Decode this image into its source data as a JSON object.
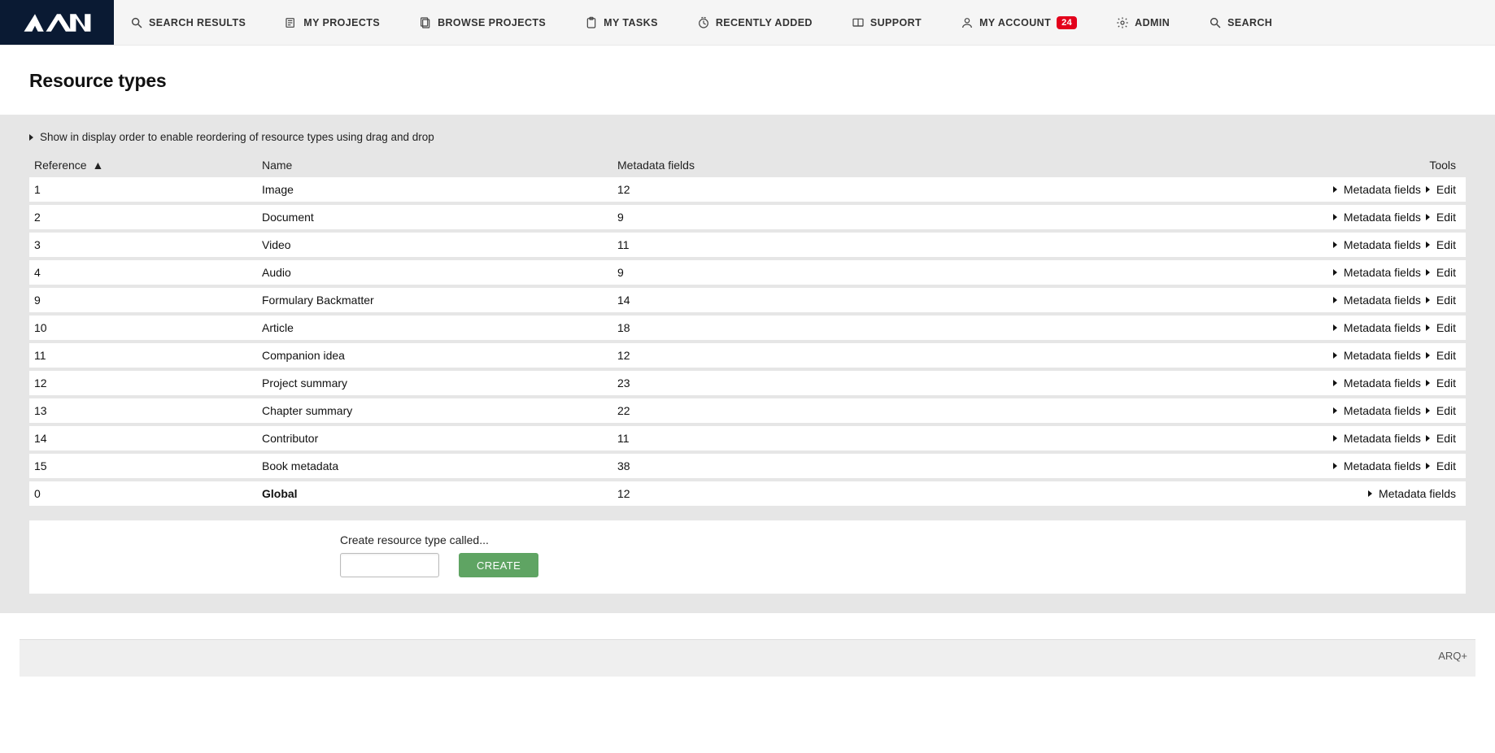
{
  "nav": {
    "items": [
      {
        "key": "search-results",
        "label": "SEARCH RESULTS",
        "icon": "search"
      },
      {
        "key": "my-projects",
        "label": "MY PROJECTS",
        "icon": "projects"
      },
      {
        "key": "browse-projects",
        "label": "BROWSE PROJECTS",
        "icon": "browse"
      },
      {
        "key": "my-tasks",
        "label": "MY TASKS",
        "icon": "tasks"
      },
      {
        "key": "recently-added",
        "label": "RECENTLY ADDED",
        "icon": "clock"
      },
      {
        "key": "support",
        "label": "SUPPORT",
        "icon": "support"
      },
      {
        "key": "my-account",
        "label": "MY ACCOUNT",
        "icon": "user",
        "badge": "24"
      },
      {
        "key": "admin",
        "label": "ADMIN",
        "icon": "gear"
      },
      {
        "key": "search",
        "label": "SEARCH",
        "icon": "search"
      }
    ]
  },
  "page": {
    "title": "Resource types"
  },
  "reorder_hint": "Show in display order to enable reordering of resource types using drag and drop",
  "table": {
    "columns": {
      "reference": "Reference",
      "sort_indicator": "▲",
      "name": "Name",
      "metadata_fields": "Metadata fields",
      "tools": "Tools"
    },
    "tool_labels": {
      "metadata_fields": "Metadata fields",
      "edit": "Edit"
    },
    "rows": [
      {
        "reference": "1",
        "name": "Image",
        "meta": "12",
        "editable": true
      },
      {
        "reference": "2",
        "name": "Document",
        "meta": "9",
        "editable": true
      },
      {
        "reference": "3",
        "name": "Video",
        "meta": "11",
        "editable": true
      },
      {
        "reference": "4",
        "name": "Audio",
        "meta": "9",
        "editable": true
      },
      {
        "reference": "9",
        "name": "Formulary Backmatter",
        "meta": "14",
        "editable": true
      },
      {
        "reference": "10",
        "name": "Article",
        "meta": "18",
        "editable": true
      },
      {
        "reference": "11",
        "name": "Companion idea",
        "meta": "12",
        "editable": true
      },
      {
        "reference": "12",
        "name": "Project summary",
        "meta": "23",
        "editable": true
      },
      {
        "reference": "13",
        "name": "Chapter summary",
        "meta": "22",
        "editable": true
      },
      {
        "reference": "14",
        "name": "Contributor",
        "meta": "11",
        "editable": true
      },
      {
        "reference": "15",
        "name": "Book metadata",
        "meta": "38",
        "editable": true
      },
      {
        "reference": "0",
        "name": "Global",
        "meta": "12",
        "editable": false,
        "bold": true
      }
    ]
  },
  "create": {
    "label": "Create resource type called...",
    "button": "CREATE"
  },
  "footer": {
    "text": "ARQ+"
  }
}
